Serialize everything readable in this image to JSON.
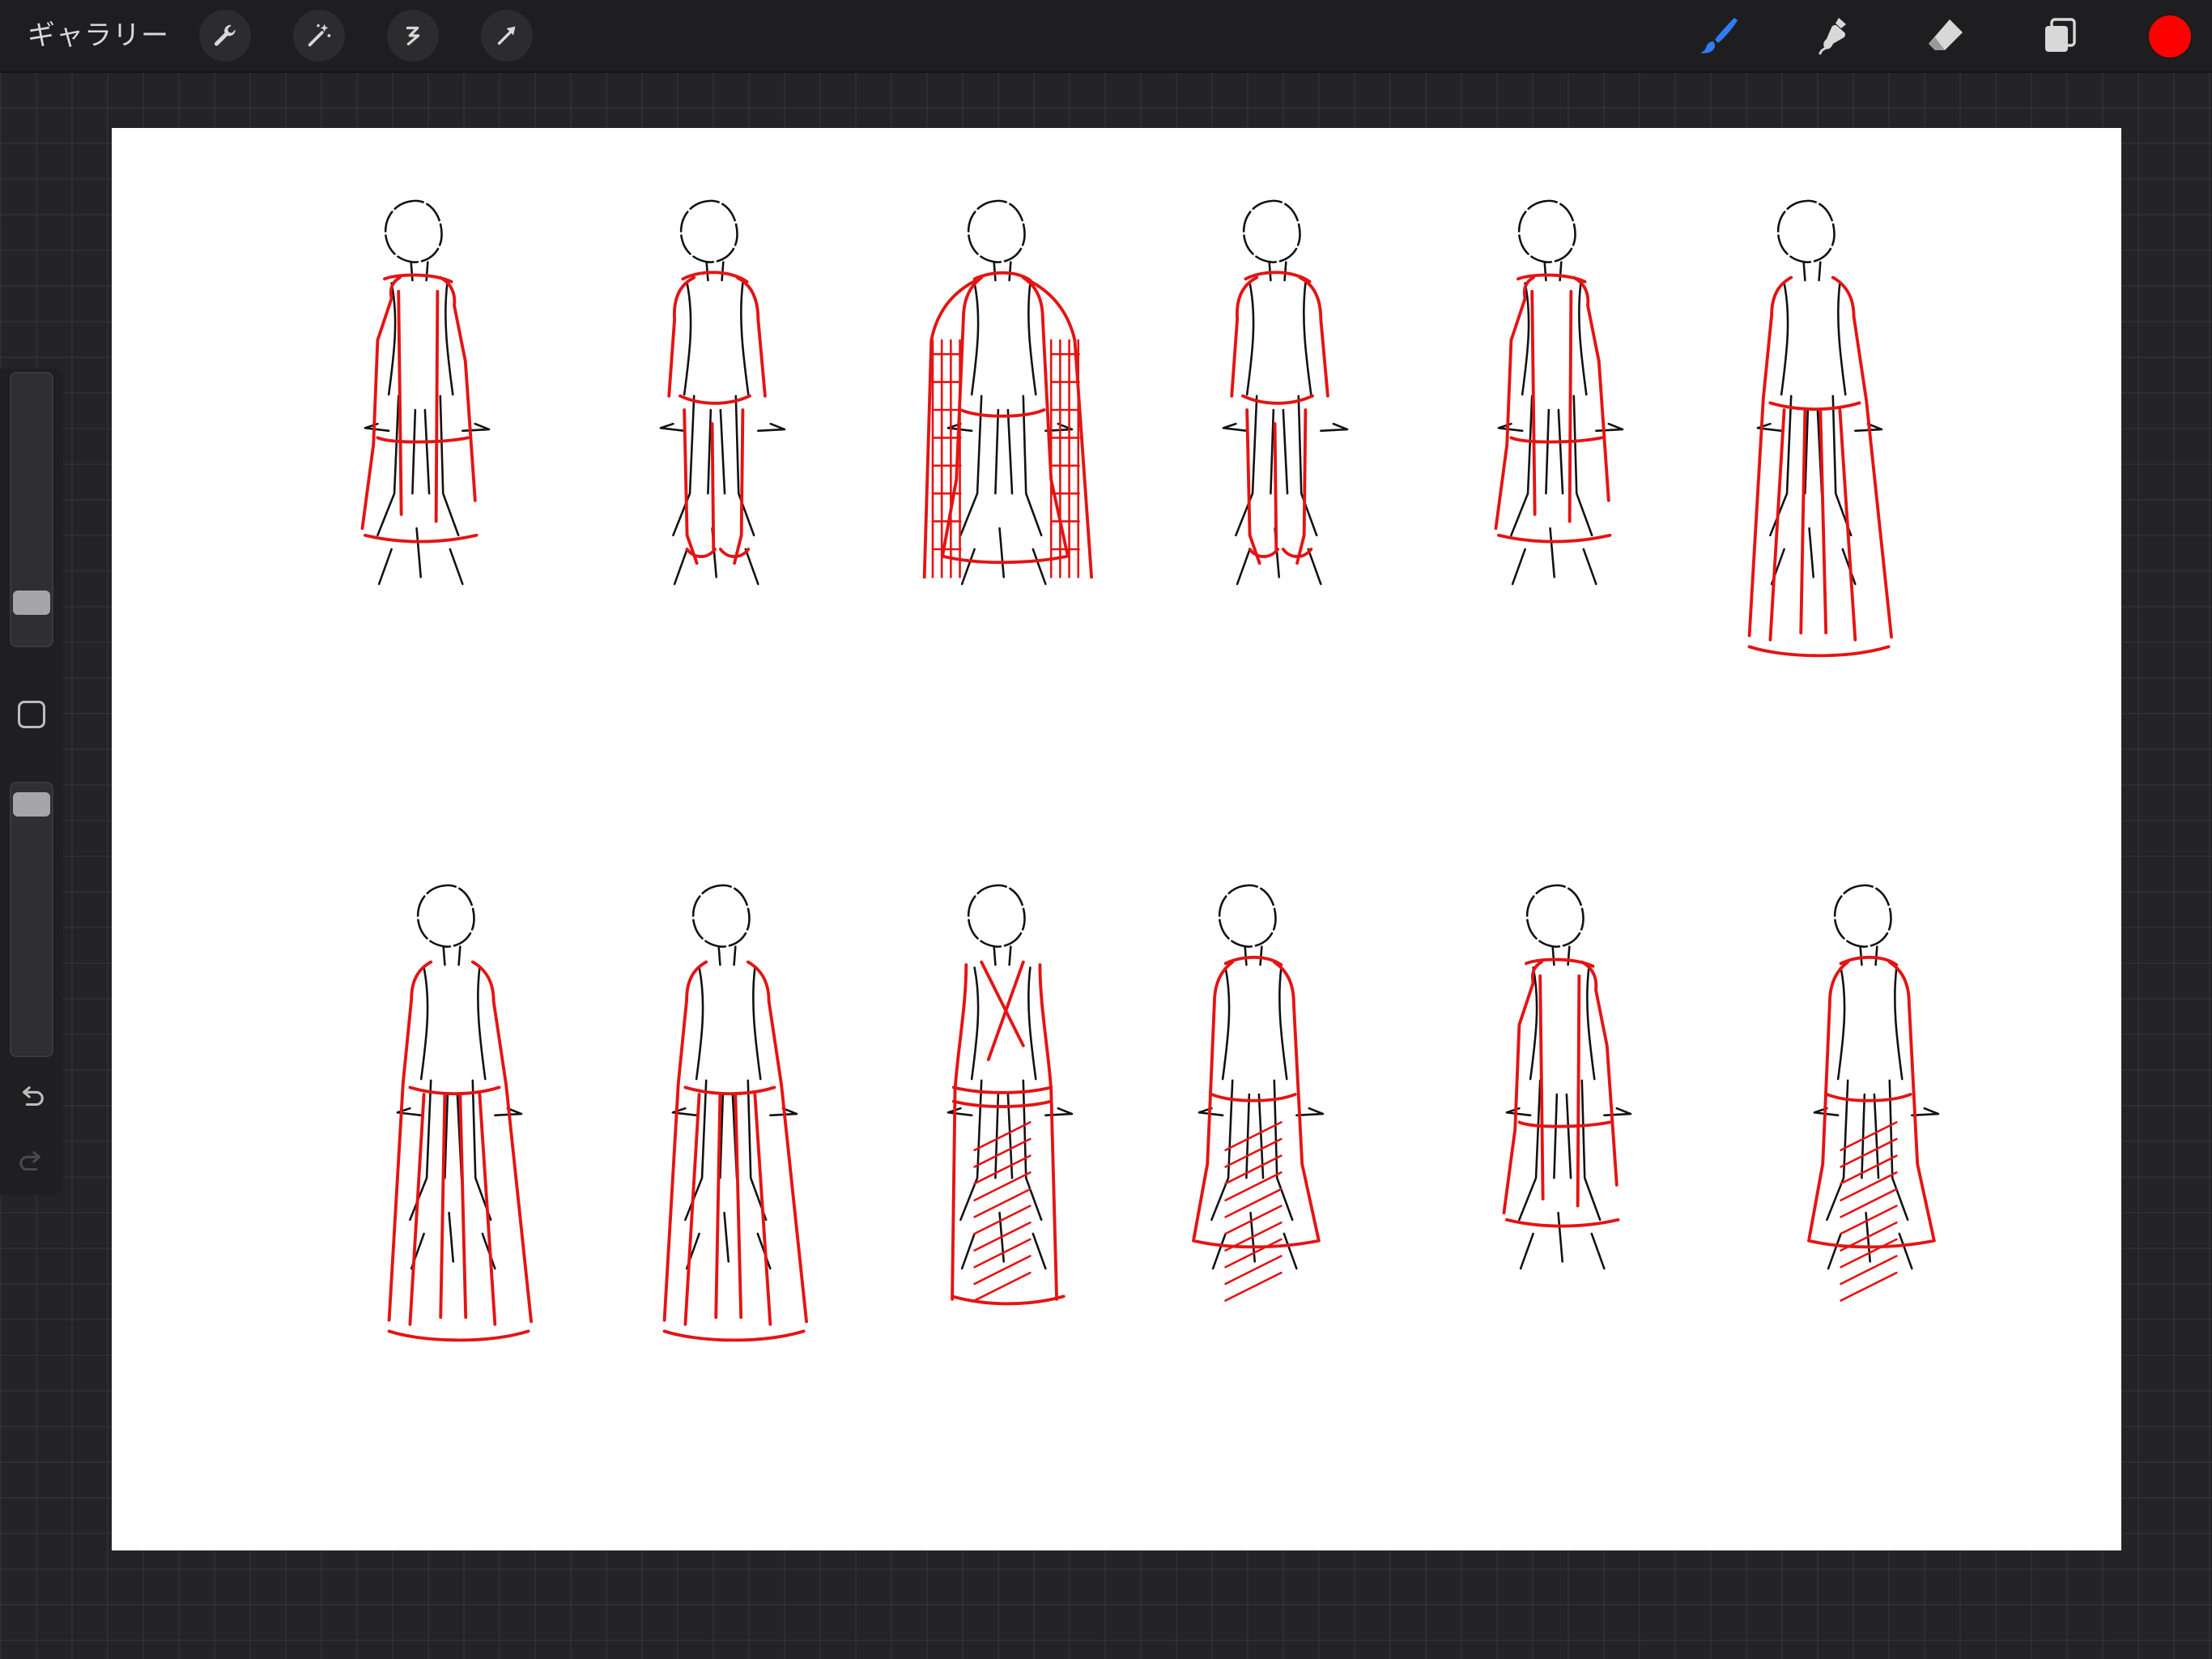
{
  "toolbar": {
    "gallery_label": "ギャラリー",
    "left_tools": [
      "actions-wrench-icon",
      "adjustments-wand-icon",
      "selection-icon",
      "transform-arrow-icon"
    ],
    "right_tools": [
      "brush-icon",
      "smudge-icon",
      "eraser-icon",
      "layers-icon"
    ],
    "active_tool": "brush-icon",
    "current_color": "#ff0000"
  },
  "sidebar": {
    "brush_size_level": 0.12,
    "opacity_level": 0.97
  },
  "colors": {
    "sketch_black": "#111111",
    "sketch_red": "#e41414",
    "accent_blue": "#2f7cf6"
  }
}
